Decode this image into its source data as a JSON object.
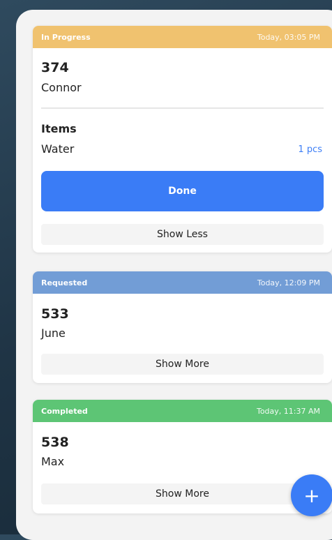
{
  "colors": {
    "in_progress": "#f0c26f",
    "requested": "#729dd6",
    "completed": "#5dc575",
    "accent": "#3a7cf6"
  },
  "orders": [
    {
      "status": "In Progress",
      "time": "Today, 03:05 PM",
      "number": "374",
      "customer": "Connor",
      "items_heading": "Items",
      "items": [
        {
          "name": "Water",
          "qty": "1 pcs"
        }
      ],
      "action_label": "Done",
      "toggle_label": "Show Less"
    },
    {
      "status": "Requested",
      "time": "Today, 12:09 PM",
      "number": "533",
      "customer": "June",
      "toggle_label": "Show More"
    },
    {
      "status": "Completed",
      "time": "Today, 11:37 AM",
      "number": "538",
      "customer": "Max",
      "toggle_label": "Show More"
    }
  ],
  "fab": {
    "icon": "plus-icon",
    "glyph": "+"
  }
}
